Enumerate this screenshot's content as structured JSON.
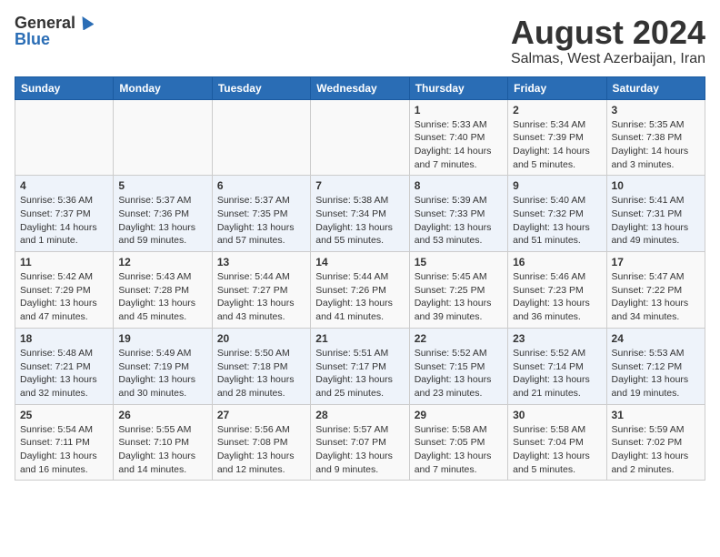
{
  "header": {
    "logo_general": "General",
    "logo_blue": "Blue",
    "title": "August 2024",
    "subtitle": "Salmas, West Azerbaijan, Iran"
  },
  "days_of_week": [
    "Sunday",
    "Monday",
    "Tuesday",
    "Wednesday",
    "Thursday",
    "Friday",
    "Saturday"
  ],
  "weeks": [
    [
      {
        "day": "",
        "info": ""
      },
      {
        "day": "",
        "info": ""
      },
      {
        "day": "",
        "info": ""
      },
      {
        "day": "",
        "info": ""
      },
      {
        "day": "1",
        "info": "Sunrise: 5:33 AM\nSunset: 7:40 PM\nDaylight: 14 hours and 7 minutes."
      },
      {
        "day": "2",
        "info": "Sunrise: 5:34 AM\nSunset: 7:39 PM\nDaylight: 14 hours and 5 minutes."
      },
      {
        "day": "3",
        "info": "Sunrise: 5:35 AM\nSunset: 7:38 PM\nDaylight: 14 hours and 3 minutes."
      }
    ],
    [
      {
        "day": "4",
        "info": "Sunrise: 5:36 AM\nSunset: 7:37 PM\nDaylight: 14 hours and 1 minute."
      },
      {
        "day": "5",
        "info": "Sunrise: 5:37 AM\nSunset: 7:36 PM\nDaylight: 13 hours and 59 minutes."
      },
      {
        "day": "6",
        "info": "Sunrise: 5:37 AM\nSunset: 7:35 PM\nDaylight: 13 hours and 57 minutes."
      },
      {
        "day": "7",
        "info": "Sunrise: 5:38 AM\nSunset: 7:34 PM\nDaylight: 13 hours and 55 minutes."
      },
      {
        "day": "8",
        "info": "Sunrise: 5:39 AM\nSunset: 7:33 PM\nDaylight: 13 hours and 53 minutes."
      },
      {
        "day": "9",
        "info": "Sunrise: 5:40 AM\nSunset: 7:32 PM\nDaylight: 13 hours and 51 minutes."
      },
      {
        "day": "10",
        "info": "Sunrise: 5:41 AM\nSunset: 7:31 PM\nDaylight: 13 hours and 49 minutes."
      }
    ],
    [
      {
        "day": "11",
        "info": "Sunrise: 5:42 AM\nSunset: 7:29 PM\nDaylight: 13 hours and 47 minutes."
      },
      {
        "day": "12",
        "info": "Sunrise: 5:43 AM\nSunset: 7:28 PM\nDaylight: 13 hours and 45 minutes."
      },
      {
        "day": "13",
        "info": "Sunrise: 5:44 AM\nSunset: 7:27 PM\nDaylight: 13 hours and 43 minutes."
      },
      {
        "day": "14",
        "info": "Sunrise: 5:44 AM\nSunset: 7:26 PM\nDaylight: 13 hours and 41 minutes."
      },
      {
        "day": "15",
        "info": "Sunrise: 5:45 AM\nSunset: 7:25 PM\nDaylight: 13 hours and 39 minutes."
      },
      {
        "day": "16",
        "info": "Sunrise: 5:46 AM\nSunset: 7:23 PM\nDaylight: 13 hours and 36 minutes."
      },
      {
        "day": "17",
        "info": "Sunrise: 5:47 AM\nSunset: 7:22 PM\nDaylight: 13 hours and 34 minutes."
      }
    ],
    [
      {
        "day": "18",
        "info": "Sunrise: 5:48 AM\nSunset: 7:21 PM\nDaylight: 13 hours and 32 minutes."
      },
      {
        "day": "19",
        "info": "Sunrise: 5:49 AM\nSunset: 7:19 PM\nDaylight: 13 hours and 30 minutes."
      },
      {
        "day": "20",
        "info": "Sunrise: 5:50 AM\nSunset: 7:18 PM\nDaylight: 13 hours and 28 minutes."
      },
      {
        "day": "21",
        "info": "Sunrise: 5:51 AM\nSunset: 7:17 PM\nDaylight: 13 hours and 25 minutes."
      },
      {
        "day": "22",
        "info": "Sunrise: 5:52 AM\nSunset: 7:15 PM\nDaylight: 13 hours and 23 minutes."
      },
      {
        "day": "23",
        "info": "Sunrise: 5:52 AM\nSunset: 7:14 PM\nDaylight: 13 hours and 21 minutes."
      },
      {
        "day": "24",
        "info": "Sunrise: 5:53 AM\nSunset: 7:12 PM\nDaylight: 13 hours and 19 minutes."
      }
    ],
    [
      {
        "day": "25",
        "info": "Sunrise: 5:54 AM\nSunset: 7:11 PM\nDaylight: 13 hours and 16 minutes."
      },
      {
        "day": "26",
        "info": "Sunrise: 5:55 AM\nSunset: 7:10 PM\nDaylight: 13 hours and 14 minutes."
      },
      {
        "day": "27",
        "info": "Sunrise: 5:56 AM\nSunset: 7:08 PM\nDaylight: 13 hours and 12 minutes."
      },
      {
        "day": "28",
        "info": "Sunrise: 5:57 AM\nSunset: 7:07 PM\nDaylight: 13 hours and 9 minutes."
      },
      {
        "day": "29",
        "info": "Sunrise: 5:58 AM\nSunset: 7:05 PM\nDaylight: 13 hours and 7 minutes."
      },
      {
        "day": "30",
        "info": "Sunrise: 5:58 AM\nSunset: 7:04 PM\nDaylight: 13 hours and 5 minutes."
      },
      {
        "day": "31",
        "info": "Sunrise: 5:59 AM\nSunset: 7:02 PM\nDaylight: 13 hours and 2 minutes."
      }
    ]
  ]
}
